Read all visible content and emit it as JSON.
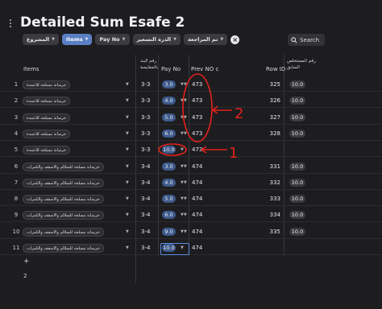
{
  "title": "Detailed Sum Esafe 2",
  "filters": [
    {
      "label": "المشروع",
      "active": false
    },
    {
      "label": "Items",
      "active": true
    },
    {
      "label": "Pay No",
      "active": false
    },
    {
      "label": "الدرة التسعير",
      "active": false
    },
    {
      "label": "تم المراجعة",
      "active": false
    }
  ],
  "search_label": "Search",
  "columns": {
    "items": "Items",
    "band_line1": "رقم البند",
    "band_line2": "بالمقايسة",
    "pay_no": "Pay No",
    "prev_no": "Prev NO c",
    "row_id": "Row ID",
    "extract_line1": "رقم المستخلص",
    "extract_line2": "السابق"
  },
  "rows": [
    {
      "n": "1",
      "item": "خرسانة مسلحة للاعمدة",
      "band": "3-3",
      "pay": "3.0",
      "prev": "473",
      "rowid": "325",
      "extract": "10.0",
      "prev_has_select": true
    },
    {
      "n": "2",
      "item": "خرسانة مسلحة للاعمدة",
      "band": "3-3",
      "pay": "4.0",
      "prev": "473",
      "rowid": "326",
      "extract": "10.0",
      "prev_has_select": true
    },
    {
      "n": "3",
      "item": "خرسانة مسلحة للاعمدة",
      "band": "3-3",
      "pay": "5.0",
      "prev": "473",
      "rowid": "327",
      "extract": "10.0",
      "prev_has_select": true
    },
    {
      "n": "4",
      "item": "خرسانة مسلحة للاعمدة",
      "band": "3-3",
      "pay": "6.0",
      "prev": "473",
      "rowid": "328",
      "extract": "10.0",
      "prev_has_select": true
    },
    {
      "n": "5",
      "item": "خرسانة مسلحة للاعمدة",
      "band": "3-3",
      "pay": "10.0",
      "prev": "473",
      "rowid": "",
      "extract": "",
      "prev_has_select": false
    },
    {
      "n": "6",
      "item": "خرسانة مسلحة للسلالم والاسقف والكمرات",
      "band": "3-4",
      "pay": "3.0",
      "prev": "474",
      "rowid": "331",
      "extract": "10.0",
      "prev_has_select": true
    },
    {
      "n": "7",
      "item": "خرسانة مسلحة للسلالم والاسقف والكمرات",
      "band": "3-4",
      "pay": "4.0",
      "prev": "474",
      "rowid": "332",
      "extract": "10.0",
      "prev_has_select": true
    },
    {
      "n": "8",
      "item": "خرسانة مسلحة للسلالم والاسقف والكمرات",
      "band": "3-4",
      "pay": "5.0",
      "prev": "474",
      "rowid": "333",
      "extract": "10.0",
      "prev_has_select": true
    },
    {
      "n": "9",
      "item": "خرسانة مسلحة للسلالم والاسقف والكمرات",
      "band": "3-4",
      "pay": "6.0",
      "prev": "474",
      "rowid": "334",
      "extract": "10.0",
      "prev_has_select": true
    },
    {
      "n": "10",
      "item": "خرسانة مسلحة للسلالم والاسقف والكمرات",
      "band": "3-4",
      "pay": "9.0",
      "prev": "474",
      "rowid": "335",
      "extract": "10.0",
      "prev_has_select": true
    },
    {
      "n": "11",
      "item": "خرسانة مسلحة للسلالم والاسقف والكمرات",
      "band": "3-4",
      "pay": "10.0",
      "prev": "474",
      "rowid": "",
      "extract": "",
      "prev_has_select": false
    }
  ],
  "add_row": "+",
  "row_count": "2",
  "annotations": {
    "one": "1",
    "two": "2",
    "color": "#e0221c"
  }
}
